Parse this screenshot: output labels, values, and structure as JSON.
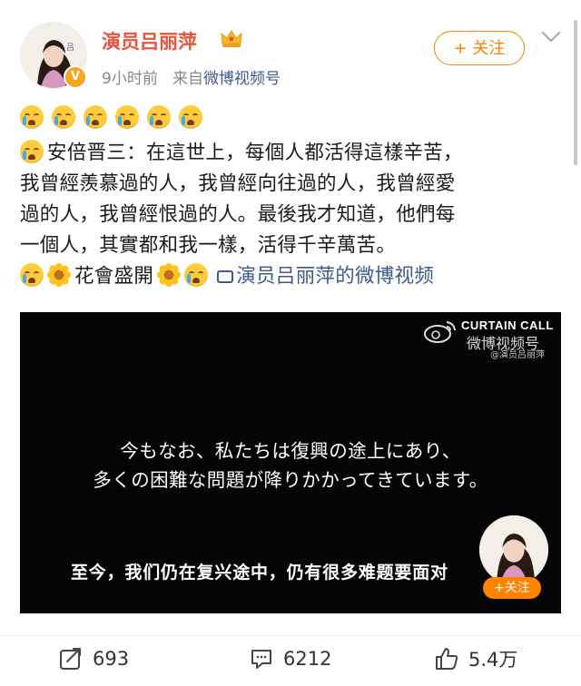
{
  "header": {
    "username": "演员吕丽萍",
    "time": "9小时前",
    "from_prefix": "来自",
    "source": "微博视频号",
    "follow_label": "+ 关注"
  },
  "post": {
    "line1": "安倍晋三：在這世上，每個人都活得這樣辛苦，",
    "line2": "我曾經羨慕過的人，我曾經向往過的人，我曾經愛",
    "line3": "過的人，我曾經恨過的人。最後我才知道，他們每",
    "line4": "一個人，其實都和我一樣，活得千辛萬苦。",
    "flower_text": "花會盛開",
    "video_link": "演员吕丽萍的微博视频"
  },
  "video": {
    "watermark_title": "CURTAIN CALL",
    "watermark_sub": "微博视频号",
    "watermark_handle": "@演员吕丽萍",
    "jp_line1": "今もなお、私たちは復興の途上にあり、",
    "jp_line2": "多くの困難な問題が降りかかってきています。",
    "cn_subtitle": "至今，我们仍在复兴途中，仍有很多难题要面对",
    "follow_label": "+关注"
  },
  "footer": {
    "reposts": "693",
    "comments": "6212",
    "likes": "5.4万"
  },
  "icons": {
    "crying": "crying-face-emoji",
    "flower": "sunflower-emoji",
    "repost": "share-icon",
    "comment": "comment-icon",
    "like": "thumbs-up-icon"
  },
  "colors": {
    "username": "#e8553d",
    "follow": "#ff8200",
    "link": "#3d5a8a",
    "video_bg": "#050505"
  }
}
